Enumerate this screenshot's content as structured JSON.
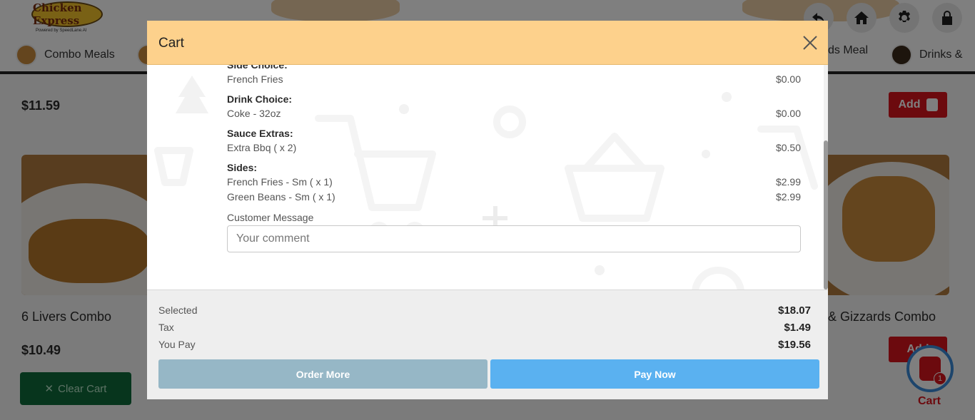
{
  "background": {
    "logo": {
      "text": "Chicken Express",
      "subtitle": "Powered by SpeedLane.AI"
    },
    "top_icons": [
      "back-icon",
      "home-icon",
      "gear-icon",
      "lock-icon"
    ],
    "categories": [
      "Combo Meals",
      "ds Meal",
      "Drinks &"
    ],
    "products": {
      "left_top_price": "$11.59",
      "left_name": "6 Livers Combo",
      "left_price": "$10.49",
      "right_name": "& Gizzards Combo"
    },
    "add_label": "Add",
    "clear_cart_label": "Clear Cart",
    "cart_label": "Cart",
    "cart_count": "1",
    "brand_red": "#d9141d"
  },
  "modal": {
    "title": "Cart",
    "options": [
      {
        "title": "Side Choice:",
        "rows": [
          {
            "name": "French Fries",
            "price": "$0.00"
          }
        ]
      },
      {
        "title": "Drink Choice:",
        "rows": [
          {
            "name": "Coke - 32oz",
            "price": "$0.00"
          }
        ]
      },
      {
        "title": "Sauce Extras:",
        "rows": [
          {
            "name": "Extra Bbq ( x 2)",
            "price": "$0.50"
          }
        ]
      },
      {
        "title": "Sides:",
        "rows": [
          {
            "name": "French Fries - Sm ( x 1)",
            "price": "$2.99"
          },
          {
            "name": "Green Beans - Sm ( x 1)",
            "price": "$2.99"
          }
        ]
      }
    ],
    "message": {
      "label": "Customer Message",
      "placeholder": "Your comment",
      "value": ""
    },
    "summary": {
      "selected_label": "Selected",
      "selected_value": "$18.07",
      "tax_label": "Tax",
      "tax_value": "$1.49",
      "pay_label": "You Pay",
      "pay_value": "$19.56"
    },
    "buttons": {
      "order_more": "Order More",
      "pay_now": "Pay Now"
    },
    "colors": {
      "header": "#fdd18c",
      "order_more": "#96b7c6",
      "pay_now": "#5ab1f0"
    }
  }
}
